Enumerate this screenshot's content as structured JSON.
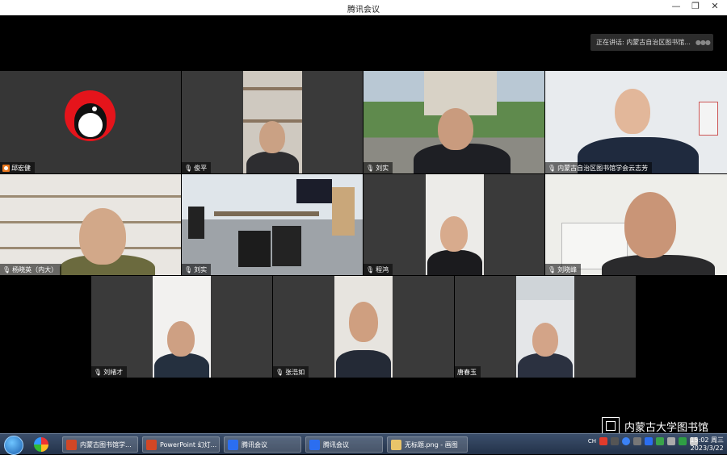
{
  "window": {
    "title": "腾讯会议",
    "minimize": "—",
    "restore": "❐",
    "close": "✕"
  },
  "speaking": {
    "label": "正在讲话: 内蒙古自治区图书馆..."
  },
  "participants": [
    {
      "name": "邱宏健",
      "role": "host"
    },
    {
      "name": "俊平"
    },
    {
      "name": "刘实"
    },
    {
      "name": "内蒙古自治区图书馆学会云志芳"
    },
    {
      "name": "杨晓英（内大）"
    },
    {
      "name": "刘实"
    },
    {
      "name": "程鸿"
    },
    {
      "name": "刘晓峰"
    },
    {
      "name": "刘绪才"
    },
    {
      "name": "张浩如"
    },
    {
      "name": "唐春玉"
    }
  ],
  "taskbar": {
    "items": [
      {
        "label": "内蒙古图书馆学...",
        "color": "#d24726"
      },
      {
        "label": "PowerPoint 幻灯...",
        "color": "#d24726"
      },
      {
        "label": "腾讯会议",
        "color": "#2b6ef0"
      },
      {
        "label": "腾讯会议",
        "color": "#2b6ef0"
      },
      {
        "label": "无标题.png - 画图",
        "color": "#e9c46a"
      }
    ],
    "tray_lang": "CH",
    "time": "15:02 周三",
    "date": "2023/3/22"
  },
  "watermark": {
    "text": "内蒙古大学图书馆"
  }
}
